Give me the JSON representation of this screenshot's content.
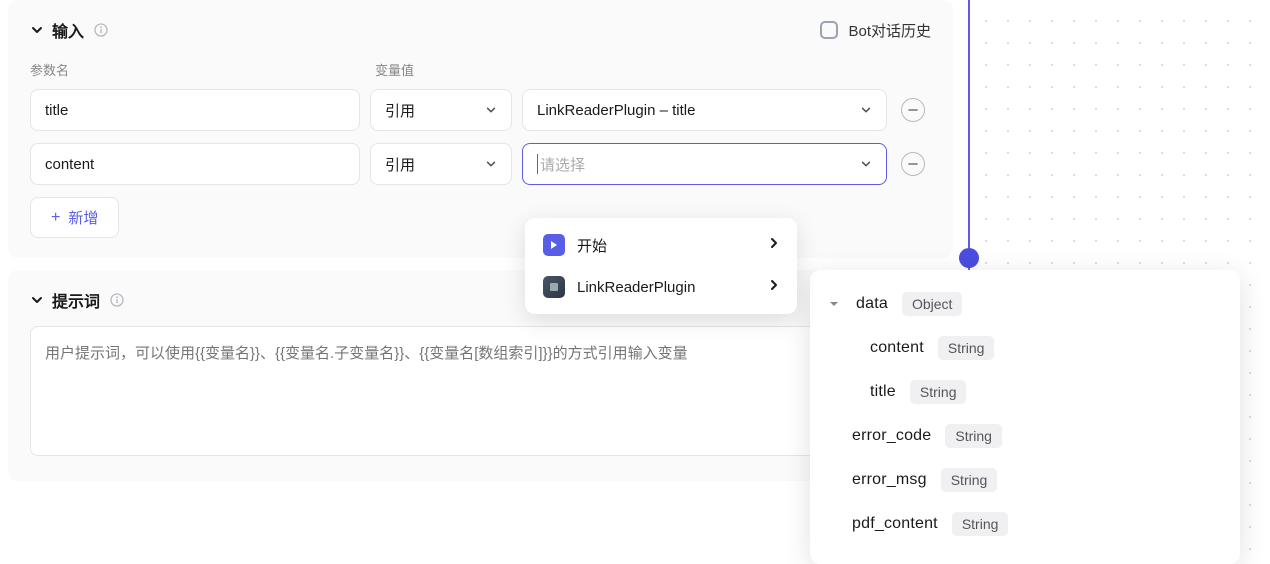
{
  "input_section": {
    "title": "输入",
    "bot_history_label": "Bot对话历史",
    "col_param_label": "参数名",
    "col_value_label": "变量值",
    "rows": [
      {
        "param": "title",
        "mode": "引用",
        "value": "LinkReaderPlugin – title"
      },
      {
        "param": "content",
        "mode": "引用",
        "value_placeholder": "请选择"
      }
    ],
    "add_button": "新增"
  },
  "dropdown": {
    "items": [
      {
        "label": "开始",
        "icon": "start"
      },
      {
        "label": "LinkReaderPlugin",
        "icon": "plugin"
      }
    ]
  },
  "prompt_section": {
    "title": "提示词",
    "placeholder": "用户提示词，可以使用{{变量名}}、{{变量名.子变量名}}、{{变量名[数组索引]}}的方式引用输入变量"
  },
  "schema_panel": {
    "root": {
      "name": "data",
      "type": "Object"
    },
    "children": [
      {
        "name": "content",
        "type": "String"
      },
      {
        "name": "title",
        "type": "String"
      }
    ],
    "siblings": [
      {
        "name": "error_code",
        "type": "String"
      },
      {
        "name": "error_msg",
        "type": "String"
      },
      {
        "name": "pdf_content",
        "type": "String"
      }
    ]
  }
}
